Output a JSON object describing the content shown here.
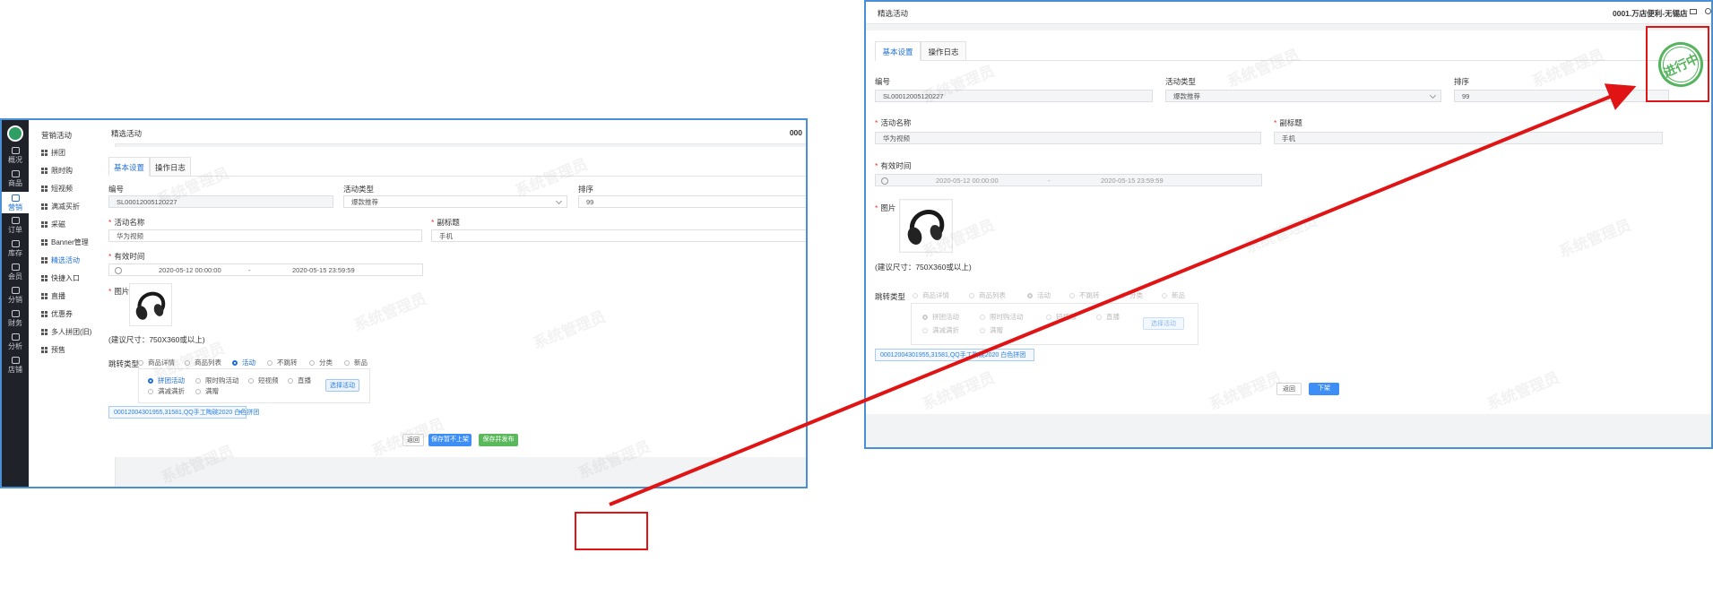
{
  "nav_rail": {
    "items": [
      "概况",
      "商品",
      "营销",
      "订单",
      "库存",
      "会员",
      "分销",
      "财务",
      "分析",
      "店铺"
    ],
    "active_index": 2
  },
  "submenu": {
    "title": "营销活动",
    "items": [
      "拼团",
      "限时购",
      "短视频",
      "满减买折",
      "采磁",
      "Banner管理",
      "精选活动",
      "快捷入口",
      "直播",
      "优惠券",
      "多人拼团(旧)",
      "预售"
    ],
    "active_index": 6
  },
  "watermark": "系统管理员",
  "left_screen": {
    "page_title": "精选活动",
    "store_truncated": "000",
    "tabs": [
      "基本设置",
      "操作日志"
    ],
    "fields": {
      "code_label": "编号",
      "code_value": "SL00012005120227",
      "type_label": "活动类型",
      "type_value": "爆款推荐",
      "sort_label": "排序",
      "sort_value": "99",
      "name_label": "活动名称",
      "name_value": "华为视频",
      "subtitle_label": "副标题",
      "subtitle_value": "手机",
      "time_label": "有效时间",
      "time_start": "2020-05-12 00:00:00",
      "time_sep": "-",
      "time_end": "2020-05-15 23:59:59",
      "image_label": "图片",
      "image_hint": "(建议尺寸：750X360或以上)",
      "jump_label": "跳转类型"
    },
    "jump_types": [
      "商品详情",
      "商品列表",
      "活动",
      "不跳转",
      "分类",
      "新品"
    ],
    "jump_selected": "活动",
    "activity_types": [
      "拼团活动",
      "限时购活动",
      "短视频",
      "直播",
      "满减满折",
      "满赠"
    ],
    "activity_selected": "拼团活动",
    "select_activity_label": "选择活动",
    "selected_tag": "00012004301955,31581,QQ手工陶碗2020 白色拼团",
    "tag_close": "×",
    "buttons": {
      "back": "返回",
      "save_no_publish": "保存暂不上架",
      "save_publish": "保存并发布"
    }
  },
  "right_screen": {
    "page_title": "精选活动",
    "store_name": "0001.万店便利-无锡店",
    "tabs": [
      "基本设置",
      "操作日志"
    ],
    "fields": {
      "code_label": "编号",
      "code_value": "SL00012005120227",
      "type_label": "活动类型",
      "type_value": "爆款推荐",
      "sort_label": "排序",
      "sort_value": "99",
      "name_label": "活动名称",
      "name_value": "华为视频",
      "subtitle_label": "副标题",
      "subtitle_value": "手机",
      "time_label": "有效时间",
      "time_start": "2020-05-12 00:00:00",
      "time_sep": "-",
      "time_end": "2020-05-15 23:59:59",
      "image_label": "图片",
      "image_hint": "(建议尺寸：750X360或以上)",
      "jump_label": "跳转类型"
    },
    "jump_types": [
      "商品详情",
      "商品列表",
      "活动",
      "不跳转",
      "分类",
      "新品"
    ],
    "jump_selected": "活动",
    "activity_types": [
      "拼团活动",
      "限时购活动",
      "短视频",
      "直播",
      "满减满折",
      "满赠"
    ],
    "activity_selected": "拼团活动",
    "select_activity_label": "选择活动",
    "selected_tag": "00012004301955,31581,QQ手工陶碗2020 白色拼团",
    "buttons": {
      "back": "返回",
      "unpublish": "下架"
    },
    "status_stamp": "进行中"
  },
  "colors": {
    "primary": "#3d8ff5",
    "success": "#5cb85c",
    "annotation": "#e01414",
    "stamp": "#55b45d",
    "frame": "#4a8fd6"
  }
}
